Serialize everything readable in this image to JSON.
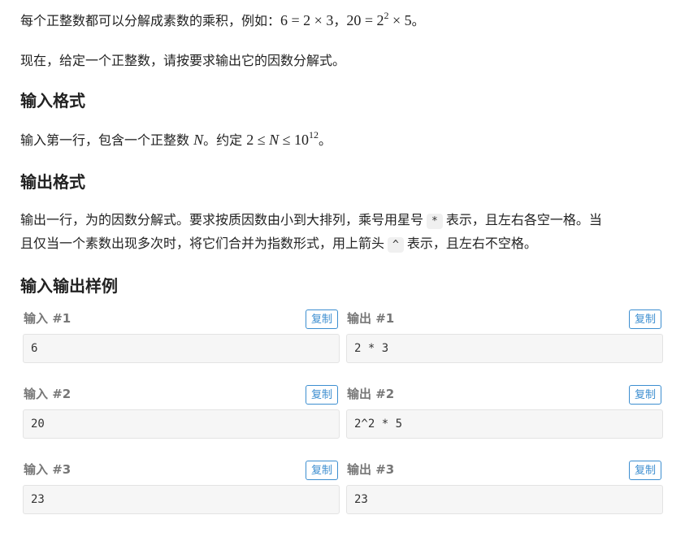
{
  "description": {
    "para1_prefix": "每个正整数都可以分解成素数的乘积，例如：",
    "para1_math1": "6 = 2 × 3",
    "para1_sep": "，",
    "para1_math2_base": "20 = 2",
    "para1_math2_exp": "2",
    "para1_math2_rest": " × 5",
    "para1_end": "。",
    "para2": "现在，给定一个正整数，请按要求输出它的因数分解式。"
  },
  "input_format": {
    "title": "输入格式",
    "text_prefix": "输入第一行，包含一个正整数 ",
    "var_N": "N",
    "text_mid": "。约定 ",
    "math_range_a": "2 ≤ ",
    "math_range_b": "N",
    "math_range_c": " ≤ 10",
    "math_range_exp": "12",
    "text_end": "。"
  },
  "output_format": {
    "title": "输出格式",
    "line1_a": "输出一行，为的因数分解式。要求按质因数由小到大排列，乘号用星号",
    "code_star": "*",
    "line1_b": "表示，且左右各空一格。当",
    "line2_a": "且仅当一个素数出现多次时，将它们合并为指数形式，用上箭头",
    "code_caret": "^",
    "line2_b": "表示，且左右不空格。"
  },
  "samples": {
    "title": "输入输出样例",
    "copy_label": "复制",
    "items": [
      {
        "input_label": "输入 #1",
        "output_label": "输出 #1",
        "input": "6",
        "output": "2 * 3"
      },
      {
        "input_label": "输入 #2",
        "output_label": "输出 #2",
        "input": "20",
        "output": "2^2 * 5"
      },
      {
        "input_label": "输入 #3",
        "output_label": "输出 #3",
        "input": "23",
        "output": "23"
      }
    ]
  },
  "colors": {
    "accent": "#3c8ed0",
    "label_gray": "#777777",
    "box_bg": "#f6f6f6"
  }
}
